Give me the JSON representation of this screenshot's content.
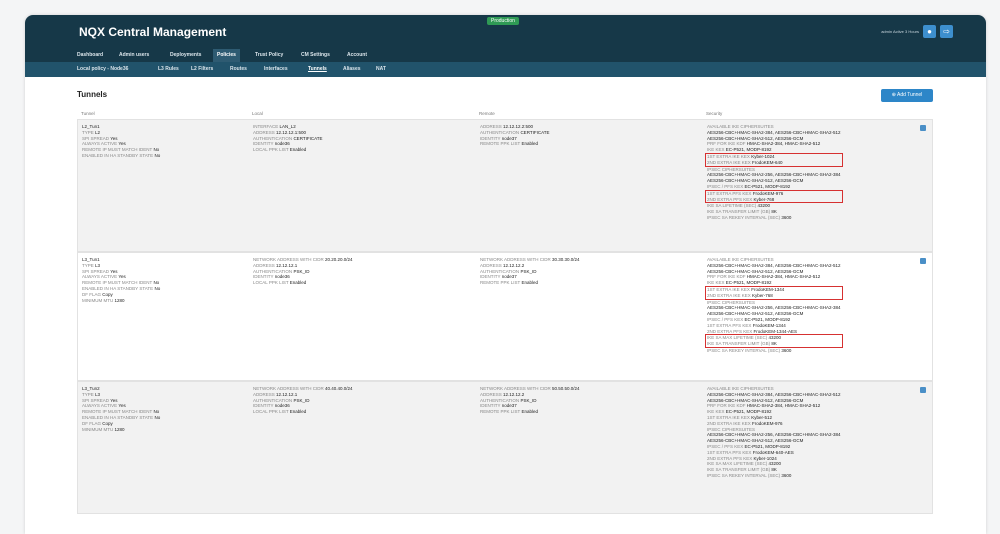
{
  "header": {
    "title": "NQX Central Management",
    "environment": "Production",
    "user": "admin Active 3 Hours"
  },
  "nav_primary": [
    "Dashboard",
    "Admin users",
    "Deployments",
    "Policies",
    "Trust Policy",
    "CM Settings",
    "Account"
  ],
  "nav_primary_active": "Policies",
  "nav_secondary": [
    "Local policy - Node36",
    "L3 Rules",
    "L2 Filters",
    "Routes",
    "Interfaces",
    "Tunnels",
    "Aliases",
    "NAT"
  ],
  "nav_secondary_active": "Tunnels",
  "page": {
    "title": "Tunnels",
    "add_label": "Add Tunnel"
  },
  "columns": [
    "Tunnel",
    "Local",
    "Remote",
    "Security"
  ],
  "rows": [
    {
      "tunnel": [
        [
          "",
          "L2_Tun1"
        ],
        [
          "TYPE",
          "L2"
        ],
        [
          "SPI SPREAD",
          "Yes"
        ],
        [
          "ALWAYS ACTIVE",
          "Yes"
        ],
        [
          "REMOTE IP MUST MATCH IDENT",
          "No"
        ],
        [
          "ENABLED IN HA STANDBY STATE",
          "No"
        ]
      ],
      "local": [
        [
          "INTERFACE",
          "LAN_L2"
        ],
        [
          "ADDRESS",
          "12.12.12.1:500"
        ],
        [
          "AUTHENTICATION",
          "CERTIFICATE"
        ],
        [
          "IDENTITY",
          "node36"
        ],
        [
          "LOCAL PPK LIST",
          "Enabled"
        ]
      ],
      "remote": [
        [
          "ADDRESS",
          "12.12.12.2:500"
        ],
        [
          "AUTHENTICATION",
          "CERTIFICATE"
        ],
        [
          "IDENTITY",
          "node37"
        ],
        [
          "REMOTE PPK LIST",
          "Enabled"
        ]
      ],
      "security": [
        {
          "l": "AVAILABLE IKE CIPHERSUITES",
          "v": ""
        },
        {
          "l": "",
          "v": "AES256-CBC+HMAC-SHA2-384, AES256-CBC+HMAC-SHA2-512"
        },
        {
          "l": "",
          "v": "AES256-CBC+HMAC-SHA2-512, AES256-GCM"
        },
        {
          "l": "PRF FOR IKE KDF",
          "v": "HMAC-SHA2-384, HMAC-SHA2-512"
        },
        {
          "l": "IKE KEX",
          "v": "EC-P521, MODP-8192"
        },
        {
          "l": "1ST EXTRA IKE KEX",
          "v": "Kyber-1024",
          "h": "s"
        },
        {
          "l": "2ND EXTRA IKE KEX",
          "v": "FrodoKEM-640",
          "h": "e"
        },
        {
          "l": "IPSEC CIPHERSUITES",
          "v": ""
        },
        {
          "l": "",
          "v": "AES256-CBC+HMAC-SHA2-256, AES256-CBC+HMAC-SHA2-384"
        },
        {
          "l": "",
          "v": "AES256-CBC+HMAC-SHA2-512, AES256-GCM"
        },
        {
          "l": "IPSEC / PFS KEX",
          "v": "EC-P521, MODP-8192"
        },
        {
          "l": "1ST EXTRA PFS KEX",
          "v": "FrodoKEM-976",
          "h": "s"
        },
        {
          "l": "2ND EXTRA PFS KEX",
          "v": "Kyber-768",
          "h": "e"
        },
        {
          "l": "IKE SA LIFETIME (SEC)",
          "v": "43200"
        },
        {
          "l": "IKE SA TRANSFER LIMIT (GB)",
          "v": "8K"
        },
        {
          "l": "IPSEC SA REKEY INTERVAL (SEC)",
          "v": "3600"
        }
      ]
    },
    {
      "tunnel": [
        [
          "",
          "L3_Tun1"
        ],
        [
          "TYPE",
          "L3"
        ],
        [
          "SPI SPREAD",
          "Yes"
        ],
        [
          "ALWAYS ACTIVE",
          "Yes"
        ],
        [
          "REMOTE IP MUST MATCH IDENT",
          "No"
        ],
        [
          "ENABLED IN HA STANDBY STATE",
          "No"
        ],
        [
          "DF FLAG",
          "Copy"
        ],
        [
          "MINIMUM MTU",
          "1280"
        ]
      ],
      "local": [
        [
          "NETWORK ADDRESS WITH CIDR",
          "20.20.20.0/24"
        ],
        [
          "ADDRESS",
          "12.12.12.1"
        ],
        [
          "AUTHENTICATION",
          "PSK_ID"
        ],
        [
          "IDENTITY",
          "node36"
        ],
        [
          "LOCAL PPK LIST",
          "Enabled"
        ]
      ],
      "remote": [
        [
          "NETWORK ADDRESS WITH CIDR",
          "30.30.30.0/24"
        ],
        [
          "ADDRESS",
          "12.12.12.2"
        ],
        [
          "AUTHENTICATION",
          "PSK_ID"
        ],
        [
          "IDENTITY",
          "node37"
        ],
        [
          "REMOTE PPK LIST",
          "Enabled"
        ]
      ],
      "security": [
        {
          "l": "AVAILABLE IKE CIPHERSUITES",
          "v": ""
        },
        {
          "l": "",
          "v": "AES256-CBC+HMAC-SHA2-384, AES256-CBC+HMAC-SHA2-512"
        },
        {
          "l": "",
          "v": "AES256-CBC+HMAC-SHA2-512, AES256-GCM"
        },
        {
          "l": "PRF FOR IKE KDF",
          "v": "HMAC-SHA2-384, HMAC-SHA2-512"
        },
        {
          "l": "IKE KEX",
          "v": "EC-P521, MODP-8192"
        },
        {
          "l": "1ST EXTRA IKE KEX",
          "v": "FrodoKEM-1344",
          "h": "s"
        },
        {
          "l": "2ND EXTRA IKE KEX",
          "v": "Kyber-768",
          "h": "e"
        },
        {
          "l": "IPSEC CIPHERSUITES",
          "v": ""
        },
        {
          "l": "",
          "v": "AES256-CBC+HMAC-SHA2-256, AES256-CBC+HMAC-SHA2-384"
        },
        {
          "l": "",
          "v": "AES256-CBC+HMAC-SHA2-512, AES256-GCM"
        },
        {
          "l": "IPSEC / PFS KEX",
          "v": "EC-P521, MODP-8192"
        },
        {
          "l": "1ST EXTRA PFS KEX",
          "v": "FrodoKEM-1344"
        },
        {
          "l": "2ND EXTRA PFS KEX",
          "v": "FrodoKEM-1344-AES"
        },
        {
          "l": "IKE SA MAX LIFETIME (SEC)",
          "v": "43200",
          "h": "s"
        },
        {
          "l": "IKE SA TRANSFER LIMIT (GB)",
          "v": "8K",
          "h": "e"
        },
        {
          "l": "IPSEC SA REKEY INTERVAL (SEC)",
          "v": "3600"
        }
      ]
    },
    {
      "tunnel": [
        [
          "",
          "L3_Tun2"
        ],
        [
          "TYPE",
          "L3"
        ],
        [
          "SPI SPREAD",
          "Yes"
        ],
        [
          "ALWAYS ACTIVE",
          "Yes"
        ],
        [
          "REMOTE IP MUST MATCH IDENT",
          "No"
        ],
        [
          "ENABLED IN HA STANDBY STATE",
          "No"
        ],
        [
          "DF FLAG",
          "Copy"
        ],
        [
          "MINIMUM MTU",
          "1280"
        ]
      ],
      "local": [
        [
          "NETWORK ADDRESS WITH CIDR",
          "40.40.40.0/24"
        ],
        [
          "ADDRESS",
          "12.12.12.1"
        ],
        [
          "AUTHENTICATION",
          "PSK_ID"
        ],
        [
          "IDENTITY",
          "node36"
        ],
        [
          "LOCAL PPK LIST",
          "Enabled"
        ]
      ],
      "remote": [
        [
          "NETWORK ADDRESS WITH CIDR",
          "50.50.50.0/24"
        ],
        [
          "ADDRESS",
          "12.12.12.2"
        ],
        [
          "AUTHENTICATION",
          "PSK_ID"
        ],
        [
          "IDENTITY",
          "node37"
        ],
        [
          "REMOTE PPK LIST",
          "Enabled"
        ]
      ],
      "security": [
        {
          "l": "AVAILABLE IKE CIPHERSUITES",
          "v": ""
        },
        {
          "l": "",
          "v": "AES256-CBC+HMAC-SHA2-384, AES256-CBC+HMAC-SHA2-512"
        },
        {
          "l": "",
          "v": "AES256-CBC+HMAC-SHA2-512, AES256-GCM"
        },
        {
          "l": "PRF FOR IKE KDF",
          "v": "HMAC-SHA2-384, HMAC-SHA2-512"
        },
        {
          "l": "IKE KEX",
          "v": "EC-P521, MODP-8192"
        },
        {
          "l": "1ST EXTRA IKE KEX",
          "v": "Kyber-512"
        },
        {
          "l": "2ND EXTRA IKE KEX",
          "v": "FrodoKEM-976"
        },
        {
          "l": "IPSEC CIPHERSUITES",
          "v": ""
        },
        {
          "l": "",
          "v": "AES256-CBC+HMAC-SHA2-256, AES256-CBC+HMAC-SHA2-384"
        },
        {
          "l": "",
          "v": "AES256-CBC+HMAC-SHA2-512, AES256-GCM"
        },
        {
          "l": "IPSEC / PFS KEX",
          "v": "EC-P521, MODP-8192"
        },
        {
          "l": "1ST EXTRA PFS KEX",
          "v": "FrodoKEM-640-AES"
        },
        {
          "l": "2ND EXTRA PFS KEX",
          "v": "Kyber-1024"
        },
        {
          "l": "IKE SA MAX LIFETIME (SEC)",
          "v": "43200"
        },
        {
          "l": "IKE SA TRANSFER LIMIT (GB)",
          "v": "8K"
        },
        {
          "l": "IPSEC SA REKEY INTERVAL (SEC)",
          "v": "3600"
        }
      ]
    }
  ]
}
